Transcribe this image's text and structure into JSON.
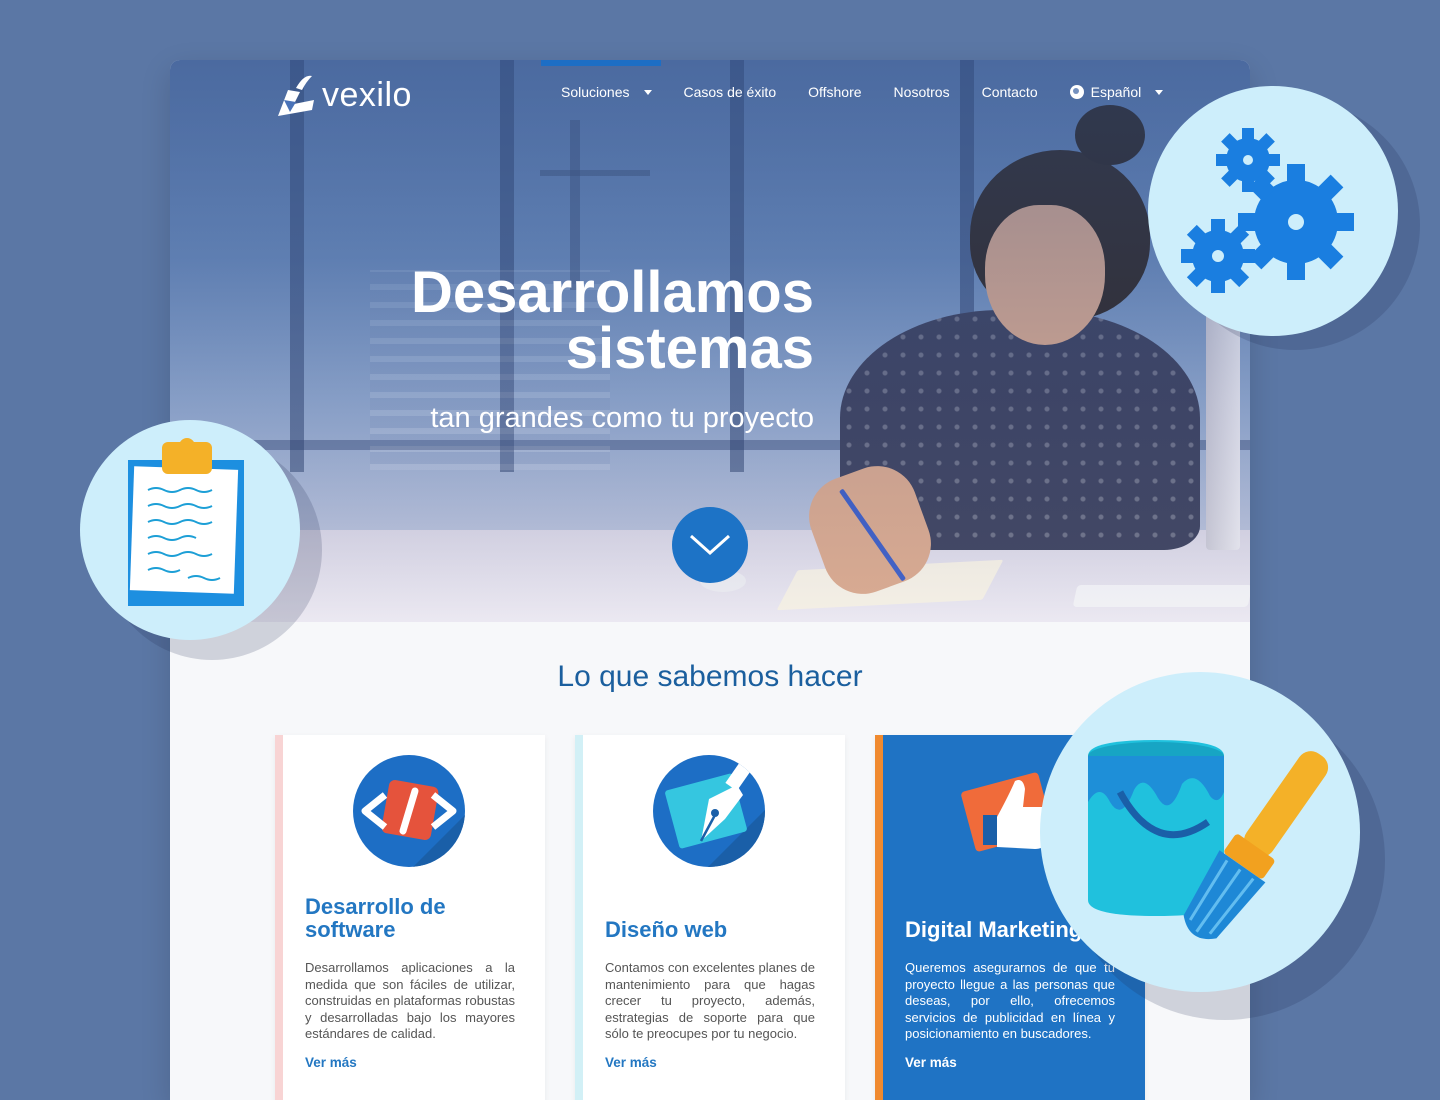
{
  "nav": {
    "logo_text": "vexilo",
    "items": [
      {
        "label": "Soluciones",
        "has_dropdown": true,
        "active": true
      },
      {
        "label": "Casos de éxito",
        "has_dropdown": false
      },
      {
        "label": "Offshore",
        "has_dropdown": false
      },
      {
        "label": "Nosotros",
        "has_dropdown": false
      },
      {
        "label": "Contacto",
        "has_dropdown": false
      }
    ],
    "language": {
      "label": "Español",
      "icon": "globe-icon"
    }
  },
  "hero": {
    "title_line1": "Desarrollamos",
    "title_line2": "sistemas",
    "subtitle": "tan grandes como tu proyecto",
    "scroll_icon": "chevron-down-icon"
  },
  "services": {
    "heading": "Lo que sabemos hacer",
    "cards": [
      {
        "title": "Desarrollo de software",
        "text": "Desarrollamos aplicaciones a la medida que son fáciles de utilizar, construidas en plataformas robustas y desarrolladas bajo los mayores estándares de calidad.",
        "link": "Ver más",
        "icon": "code-icon",
        "stripe_color": "#f8d4d4"
      },
      {
        "title": "Diseño web",
        "text": "Contamos con excelentes planes de mantenimiento para que hagas crecer tu proyecto, además, estrategias de soporte para que sólo te preocupes por tu negocio.",
        "link": "Ver más",
        "icon": "pen-nib-icon",
        "stripe_color": "#d2f0f6"
      },
      {
        "title": "Digital Marketing",
        "text": "Queremos asegurarnos de que tu proyecto llegue a las personas que deseas, por ello, ofrecemos servicios de publicidad en línea y posicionamiento en buscadores.",
        "link": "Ver más",
        "icon": "thumbs-up-icon",
        "stripe_color": "#f08a2f"
      }
    ]
  },
  "badges": [
    "clipboard-icon",
    "gears-icon",
    "paint-bucket-icon"
  ],
  "colors": {
    "background": "#5b77a5",
    "accent": "#1d6ec5",
    "heading": "#1b5f9e",
    "badge": "#cdeefb"
  }
}
